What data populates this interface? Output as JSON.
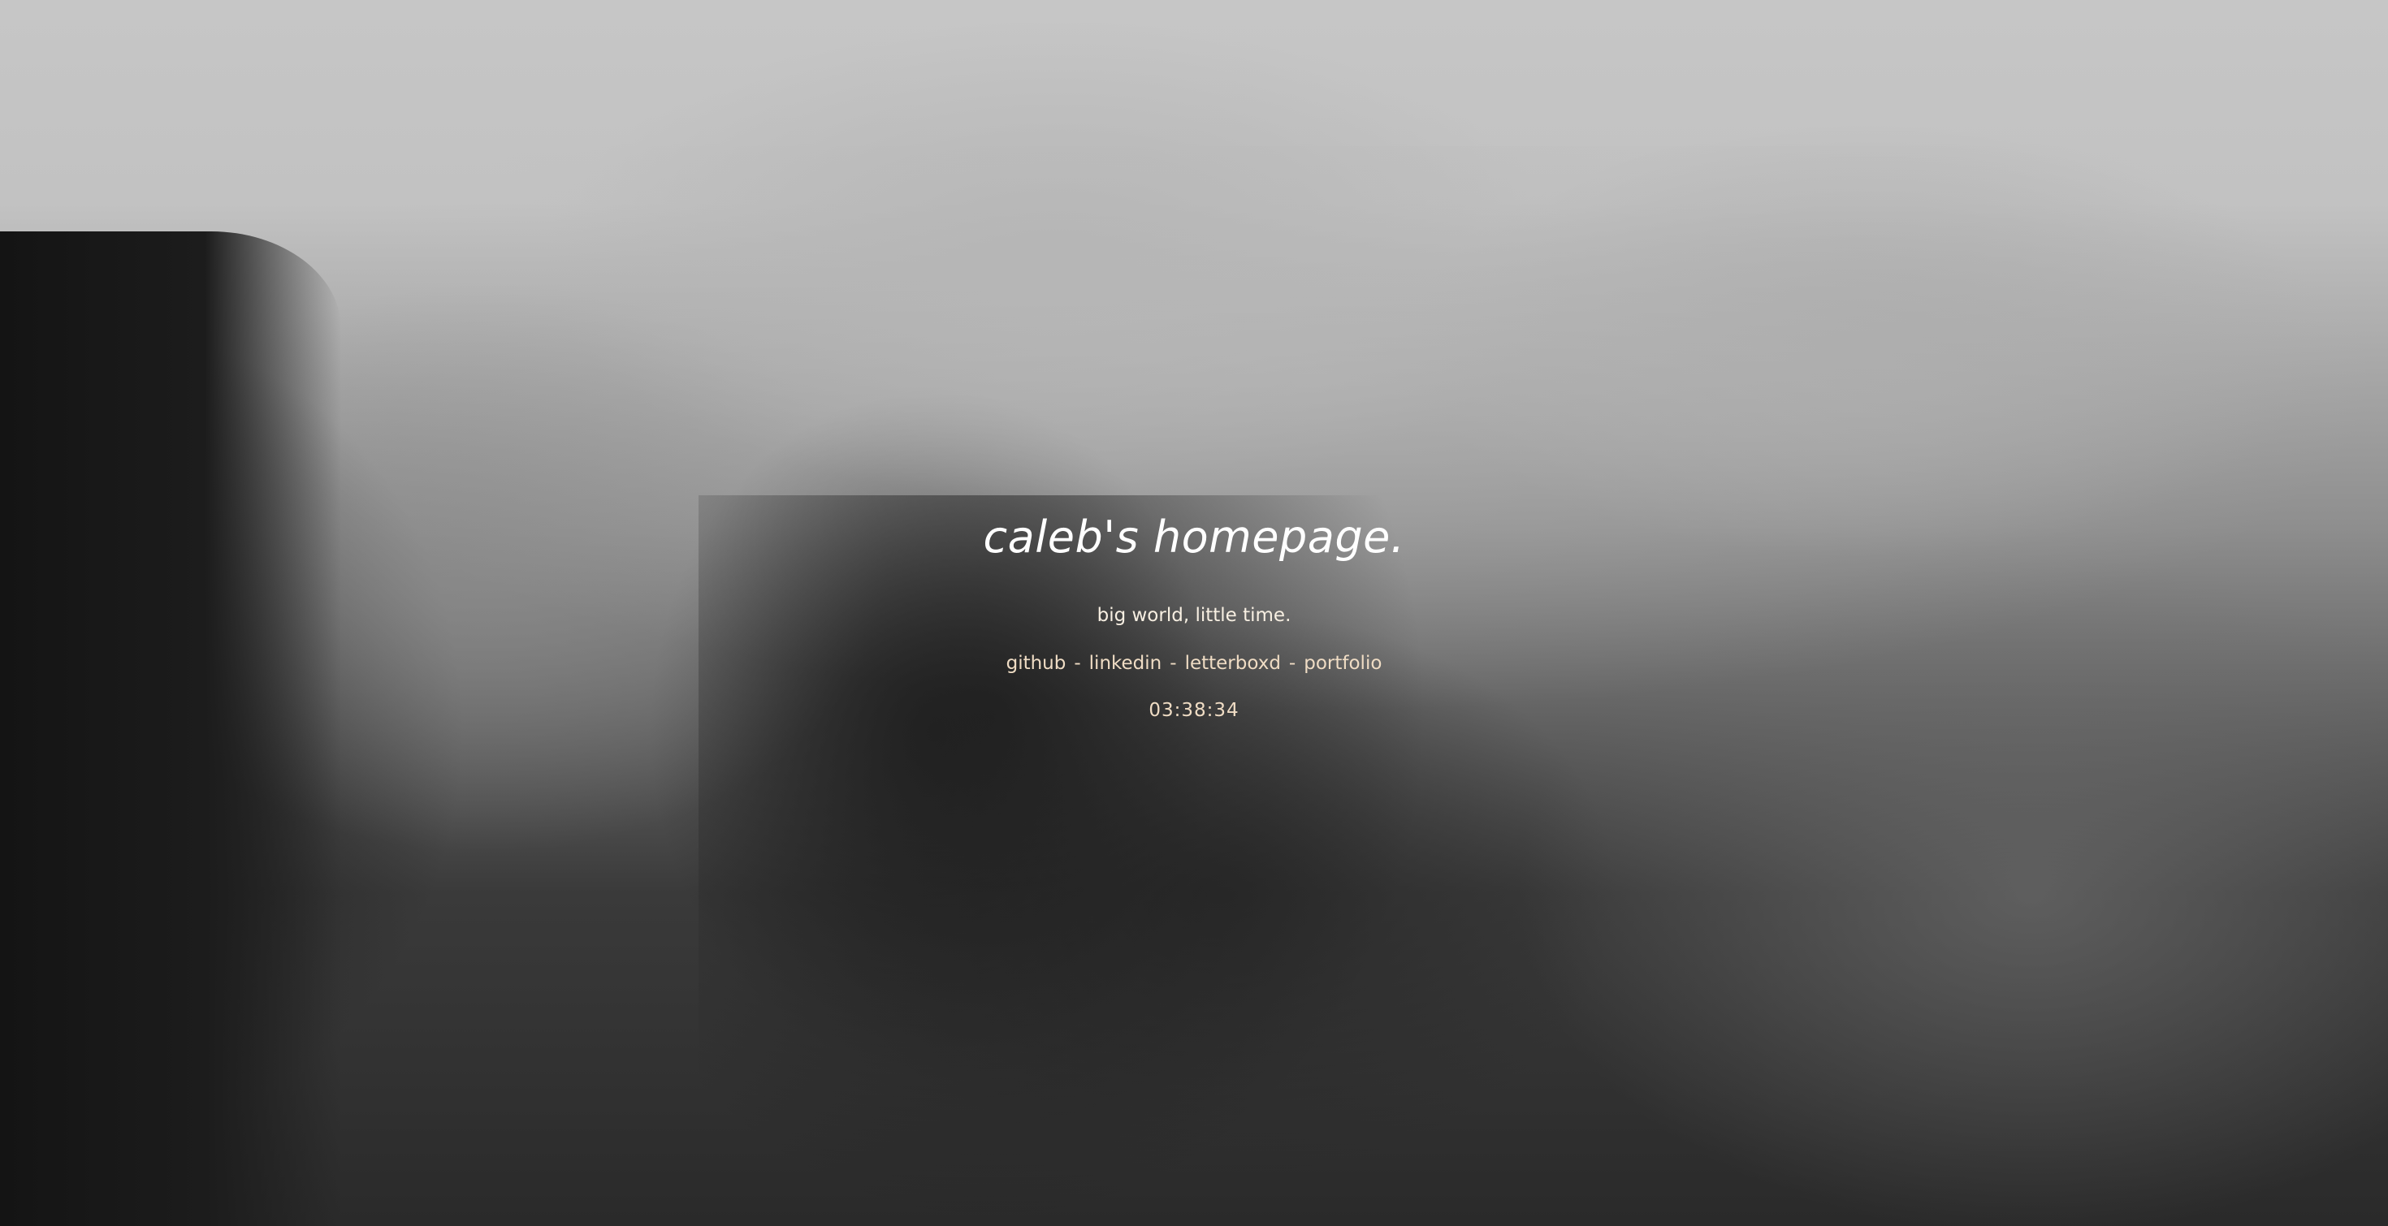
{
  "page": {
    "title": "caleb's homepage.",
    "tagline": "big world, little time.",
    "links": [
      {
        "label": "github"
      },
      {
        "label": "linkedin"
      },
      {
        "label": "letterboxd"
      },
      {
        "label": "portfolio"
      }
    ],
    "separator": "-",
    "clock": "03:38:34"
  },
  "background": {
    "description_icon": "misty-mountain-photo",
    "colors": {
      "sky": "#c4c4c4",
      "dark": "#1c1c1c",
      "text": "#f3e8d8"
    }
  }
}
